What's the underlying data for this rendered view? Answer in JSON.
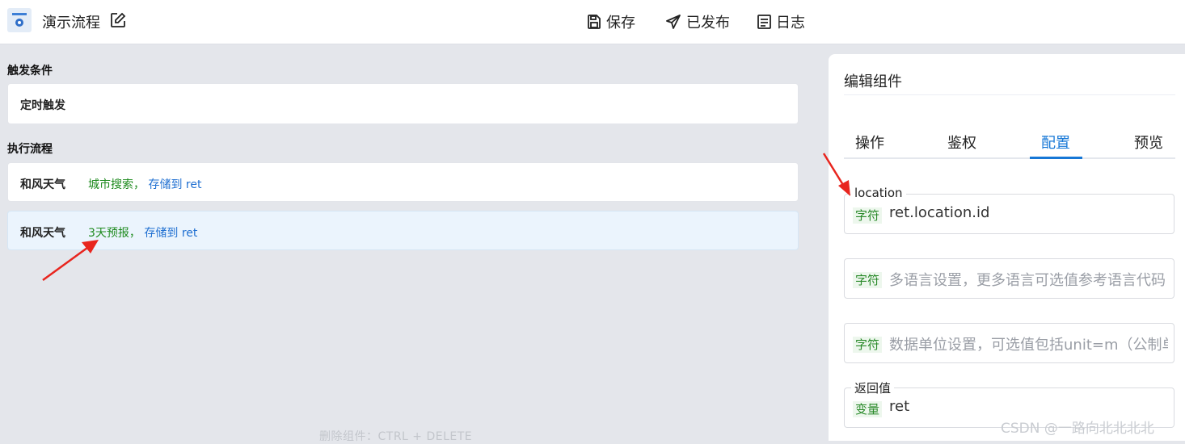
{
  "header": {
    "title": "演示流程",
    "save_label": "保存",
    "published_label": "已发布",
    "log_label": "日志"
  },
  "trigger": {
    "section_title": "触发条件",
    "item_label": "定时触发"
  },
  "flow": {
    "section_title": "执行流程",
    "steps": [
      {
        "name": "和风天气",
        "action": "城市搜索，",
        "store": "存储到 ret"
      },
      {
        "name": "和风天气",
        "action": "3天预报，",
        "store": "存储到 ret"
      }
    ],
    "hint": "删除组件：CTRL + DELETE"
  },
  "panel": {
    "title": "编辑组件",
    "tabs": [
      "操作",
      "鉴权",
      "配置",
      "预览"
    ],
    "active_tab": "配置",
    "fields": [
      {
        "legend": "location",
        "tag": "字符",
        "value": "ret.location.id",
        "placeholder": ""
      },
      {
        "legend": "",
        "tag": "字符",
        "value": "",
        "placeholder": "多语言设置，更多语言可选值参考语言代码"
      },
      {
        "legend": "",
        "tag": "字符",
        "value": "",
        "placeholder": "数据单位设置，可选值包括unit=m（公制单"
      },
      {
        "legend": "返回值",
        "tag": "变量",
        "value": "ret",
        "placeholder": ""
      }
    ]
  },
  "watermark": "CSDN @一路向北北北北",
  "colors": {
    "accent": "#1677d6",
    "green": "#1e8a1e",
    "annotation_arrow": "#e8251e"
  }
}
